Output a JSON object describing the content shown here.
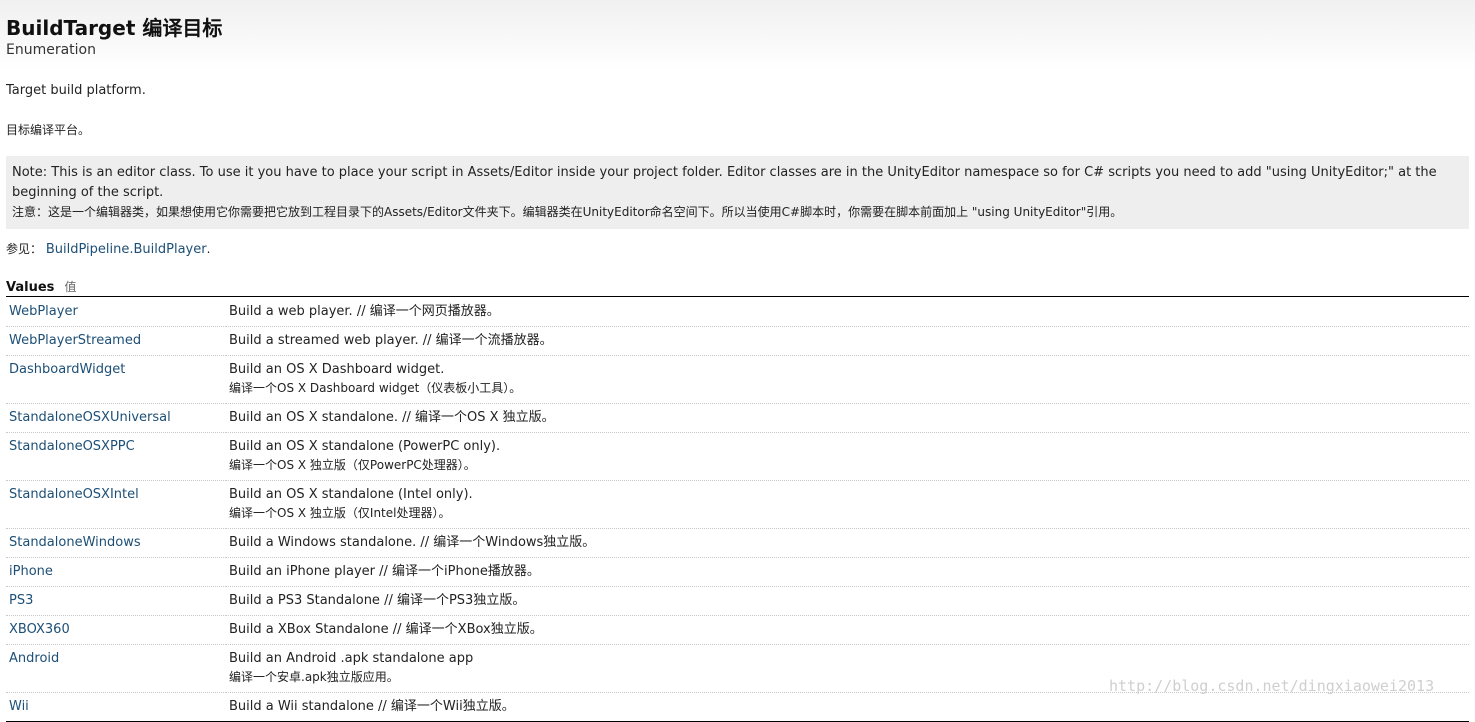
{
  "header": {
    "title": "BuildTarget 编译目标",
    "subtitle": "Enumeration"
  },
  "description": {
    "en": "Target build platform.",
    "cn": "目标编译平台。"
  },
  "note": {
    "en": "Note: This is an editor class. To use it you have to place your script in Assets/Editor inside your project folder. Editor classes are in the UnityEditor namespace so for C# scripts you need to add \"using UnityEditor;\" at the beginning of the script.",
    "cn": "注意：这是一个编辑器类，如果想使用它你需要把它放到工程目录下的Assets/Editor文件夹下。编辑器类在UnityEditor命名空间下。所以当使用C#脚本时，你需要在脚本前面加上 \"using UnityEditor\"引用。"
  },
  "see_also": {
    "label": "参见：",
    "link": "BuildPipeline.BuildPlayer",
    "suffix": "."
  },
  "values": {
    "heading": "Values",
    "heading_cn": "值",
    "rows": [
      {
        "name": "WebPlayer",
        "line1": "Build a web player. // 编译一个网页播放器。",
        "line2": ""
      },
      {
        "name": "WebPlayerStreamed",
        "line1": "Build a streamed web player. // 编译一个流播放器。",
        "line2": ""
      },
      {
        "name": "DashboardWidget",
        "line1": "Build an OS X Dashboard widget.",
        "line2": "编译一个OS X Dashboard widget（仪表板小工具）。"
      },
      {
        "name": "StandaloneOSXUniversal",
        "line1": "Build an OS X standalone. // 编译一个OS X 独立版。",
        "line2": ""
      },
      {
        "name": "StandaloneOSXPPC",
        "line1": "Build an OS X standalone (PowerPC only).",
        "line2": "编译一个OS X 独立版（仅PowerPC处理器）。"
      },
      {
        "name": "StandaloneOSXIntel",
        "line1": "Build an OS X standalone (Intel only).",
        "line2": "编译一个OS X 独立版（仅Intel处理器）。"
      },
      {
        "name": "StandaloneWindows",
        "line1": "Build a Windows standalone. // 编译一个Windows独立版。",
        "line2": ""
      },
      {
        "name": "iPhone",
        "line1": "Build an iPhone player // 编译一个iPhone播放器。",
        "line2": ""
      },
      {
        "name": "PS3",
        "line1": "Build a PS3 Standalone // 编译一个PS3独立版。",
        "line2": ""
      },
      {
        "name": "XBOX360",
        "line1": "Build a XBox Standalone // 编译一个XBox独立版。",
        "line2": ""
      },
      {
        "name": "Android",
        "line1": "Build an Android .apk standalone app",
        "line2": "编译一个安卓.apk独立版应用。"
      },
      {
        "name": "Wii",
        "line1": "Build a Wii standalone // 编译一个Wii独立版。",
        "line2": ""
      }
    ]
  },
  "watermark": "http://blog.csdn.net/dingxiaowei2013",
  "colors": {
    "link": "#1d4f76",
    "note_background": "#eeeeee"
  }
}
